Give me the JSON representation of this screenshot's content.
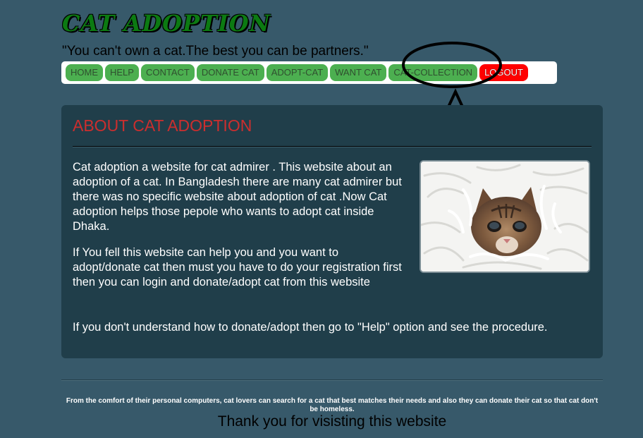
{
  "header": {
    "title": "CAT ADOPTION",
    "tagline": "\"You can't own a cat.The best you can be partners.\""
  },
  "nav": {
    "items": [
      {
        "label": "HOME"
      },
      {
        "label": "HELP"
      },
      {
        "label": "CONTACT"
      },
      {
        "label": "DONATE CAT"
      },
      {
        "label": "ADOPT-CAT"
      },
      {
        "label": "WANT CAT"
      },
      {
        "label": "CAT-COLLECTION"
      },
      {
        "label": "LOGOUT"
      }
    ]
  },
  "about": {
    "heading": "ABOUT CAT ADOPTION",
    "paragraph1": "Cat adoption a website for cat admirer . This website about an adoption of a cat. In Bangladesh there are many cat admirer but there was no specific website about adoption of cat .Now Cat adoption helps those pepole who wants to adopt cat inside Dhaka.",
    "paragraph2": "If You fell this website can help you and you want to adopt/donate cat then must you have to do your registration first then you can login and donate/adopt cat from this website",
    "paragraph3": "If you don't understand how to donate/adopt then go to \"Help\" option and see the procedure.",
    "image_icon": "kitten-photo"
  },
  "footer": {
    "small_text": "From the comfort of their personal computers, cat lovers can search for a cat that best matches their needs and also they can donate their cat so that cat don't be homeless.",
    "thanks": "Thank you for visisting this website"
  },
  "colors": {
    "background": "#37596a",
    "panel": "#203e4a",
    "title_green": "#0c7a12",
    "nav_green": "#4caf50",
    "logout_red": "#ff0000",
    "heading_red": "#cc2e2e"
  }
}
